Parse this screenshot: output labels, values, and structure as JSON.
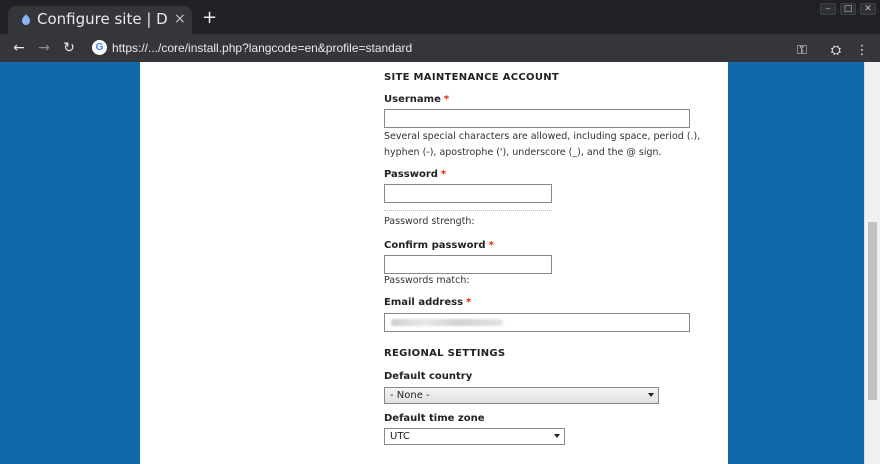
{
  "browser": {
    "tab_title": "Configure site | Dru",
    "tab_close": "×",
    "new_tab": "+",
    "window_buttons": [
      "‒",
      "□",
      "✕"
    ],
    "back": "←",
    "forward": "→",
    "reload": "↻",
    "url": "https://.../core/install.php?langcode=en&profile=standard",
    "key_icon": "⚿",
    "incognito_icon": "⛭",
    "menu_icon": "⋮"
  },
  "form": {
    "maintenance_title": "SITE MAINTENANCE ACCOUNT",
    "username_label": "Username",
    "username_value": "",
    "username_desc": "Several special characters are allowed, including space, period (.), hyphen (-), apostrophe ('), underscore (_), and the @ sign.",
    "password_label": "Password",
    "password_value": "",
    "password_strength": "Password strength:",
    "confirm_label": "Confirm password",
    "confirm_value": "",
    "passwords_match": "Passwords match:",
    "email_label": "Email address",
    "required_marker": "*",
    "regional_title": "REGIONAL SETTINGS",
    "country_label": "Default country",
    "country_value": "- None -",
    "timezone_label": "Default time zone",
    "timezone_value": "UTC"
  },
  "colors": {
    "page_background": "#1269a9",
    "required": "#e62600"
  }
}
